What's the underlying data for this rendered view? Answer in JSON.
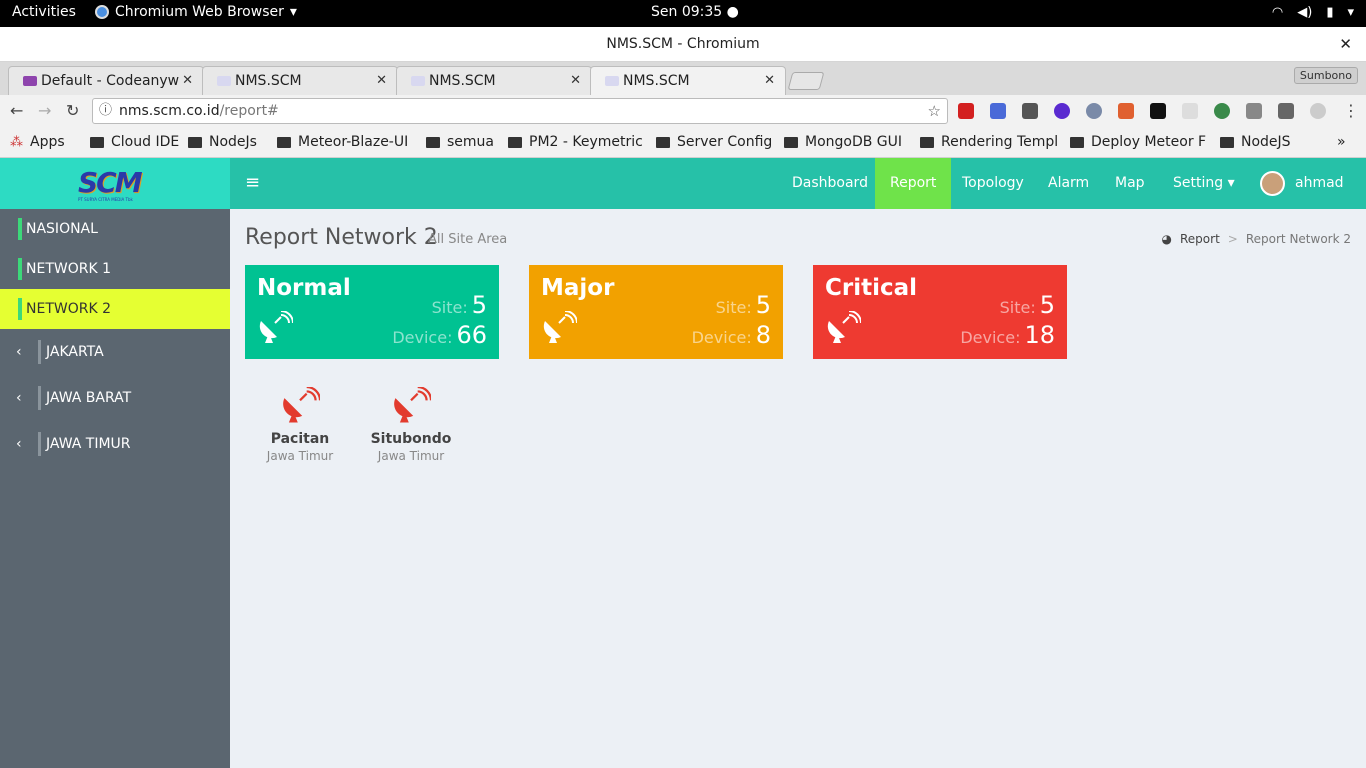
{
  "os": {
    "activities": "Activities",
    "app": "Chromium Web Browser",
    "clock": "Sen 09:35 ●"
  },
  "window": {
    "title": "NMS.SCM - Chromium",
    "close": "✕"
  },
  "tabs": [
    {
      "label": "Default - Codeanyw",
      "close": "✕"
    },
    {
      "label": "NMS.SCM",
      "close": "✕"
    },
    {
      "label": "NMS.SCM",
      "close": "✕"
    },
    {
      "label": "NMS.SCM",
      "close": "✕"
    }
  ],
  "profile": "Sumbono",
  "address": {
    "domain": "nms.scm.co.id",
    "path": "/report#"
  },
  "bookmarks": [
    "Apps",
    "Cloud IDE",
    "NodeJs",
    "Meteor-Blaze-UI",
    "semua",
    "PM2 - Keymetric",
    "Server Config",
    "MongoDB GUI",
    "Rendering Templ",
    "Deploy Meteor F",
    "NodeJS"
  ],
  "bookmarks_more": "»",
  "logo": "SCM",
  "logo_caption": "PT SURYA CITRA MEDIA Tbk",
  "sidebar": {
    "items": [
      {
        "label": "NASIONAL"
      },
      {
        "label": "NETWORK 1"
      },
      {
        "label": "NETWORK 2"
      }
    ],
    "subitems": [
      {
        "label": "JAKARTA"
      },
      {
        "label": "JAWA BARAT"
      },
      {
        "label": "JAWA TIMUR"
      }
    ]
  },
  "topnav": {
    "items": [
      "Dashboard",
      "Report",
      "Topology",
      "Alarm",
      "Map",
      "Setting ▾"
    ],
    "user": "ahmad"
  },
  "page": {
    "title": "Report Network 2",
    "subtitle": "All Site Area",
    "breadcrumb": {
      "root": "Report",
      "sep": ">",
      "current": "Report Network 2"
    }
  },
  "cards": [
    {
      "title": "Normal",
      "site_label": "Site:",
      "site": "5",
      "device_label": "Device:",
      "device": "66",
      "color": "#00c292"
    },
    {
      "title": "Major",
      "site_label": "Site:",
      "site": "5",
      "device_label": "Device:",
      "device": "8",
      "color": "#f2a100"
    },
    {
      "title": "Critical",
      "site_label": "Site:",
      "site": "5",
      "device_label": "Device:",
      "device": "18",
      "color": "#ee3a31"
    }
  ],
  "sites": [
    {
      "name": "Pacitan",
      "region": "Jawa Timur",
      "icon": "satellite-dish-icon",
      "color": "#e23b2e"
    },
    {
      "name": "Situbondo",
      "region": "Jawa Timur",
      "icon": "satellite-dish-icon",
      "color": "#e23b2e"
    }
  ]
}
